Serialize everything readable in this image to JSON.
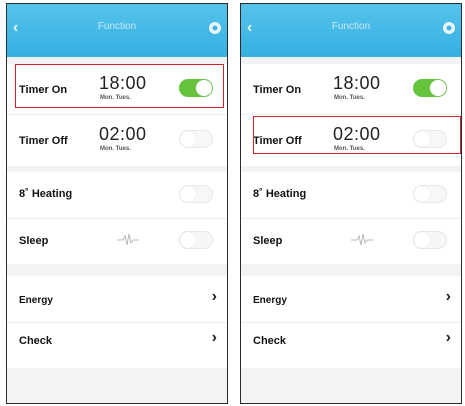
{
  "header": {
    "title": "Function"
  },
  "rows": {
    "timer_on": {
      "label": "Timer On",
      "time": "18:00",
      "days": "Mon. Tues."
    },
    "timer_off": {
      "label": "Timer Off",
      "time": "02:00",
      "days": "Mon. Tues."
    },
    "heating": {
      "label": "8˚ Heating"
    },
    "sleep": {
      "label": "Sleep"
    },
    "energy": {
      "label": "Energy"
    },
    "check": {
      "label": "Check"
    }
  },
  "icons": {
    "chevron": "›",
    "back": "‹"
  },
  "states": {
    "timer_on_enabled": true,
    "timer_off_enabled": false,
    "heating_enabled": false,
    "sleep_enabled": false
  },
  "colors": {
    "header": "#3fb6e4",
    "toggle_on": "#66c43c",
    "highlight": "#d9202a"
  }
}
